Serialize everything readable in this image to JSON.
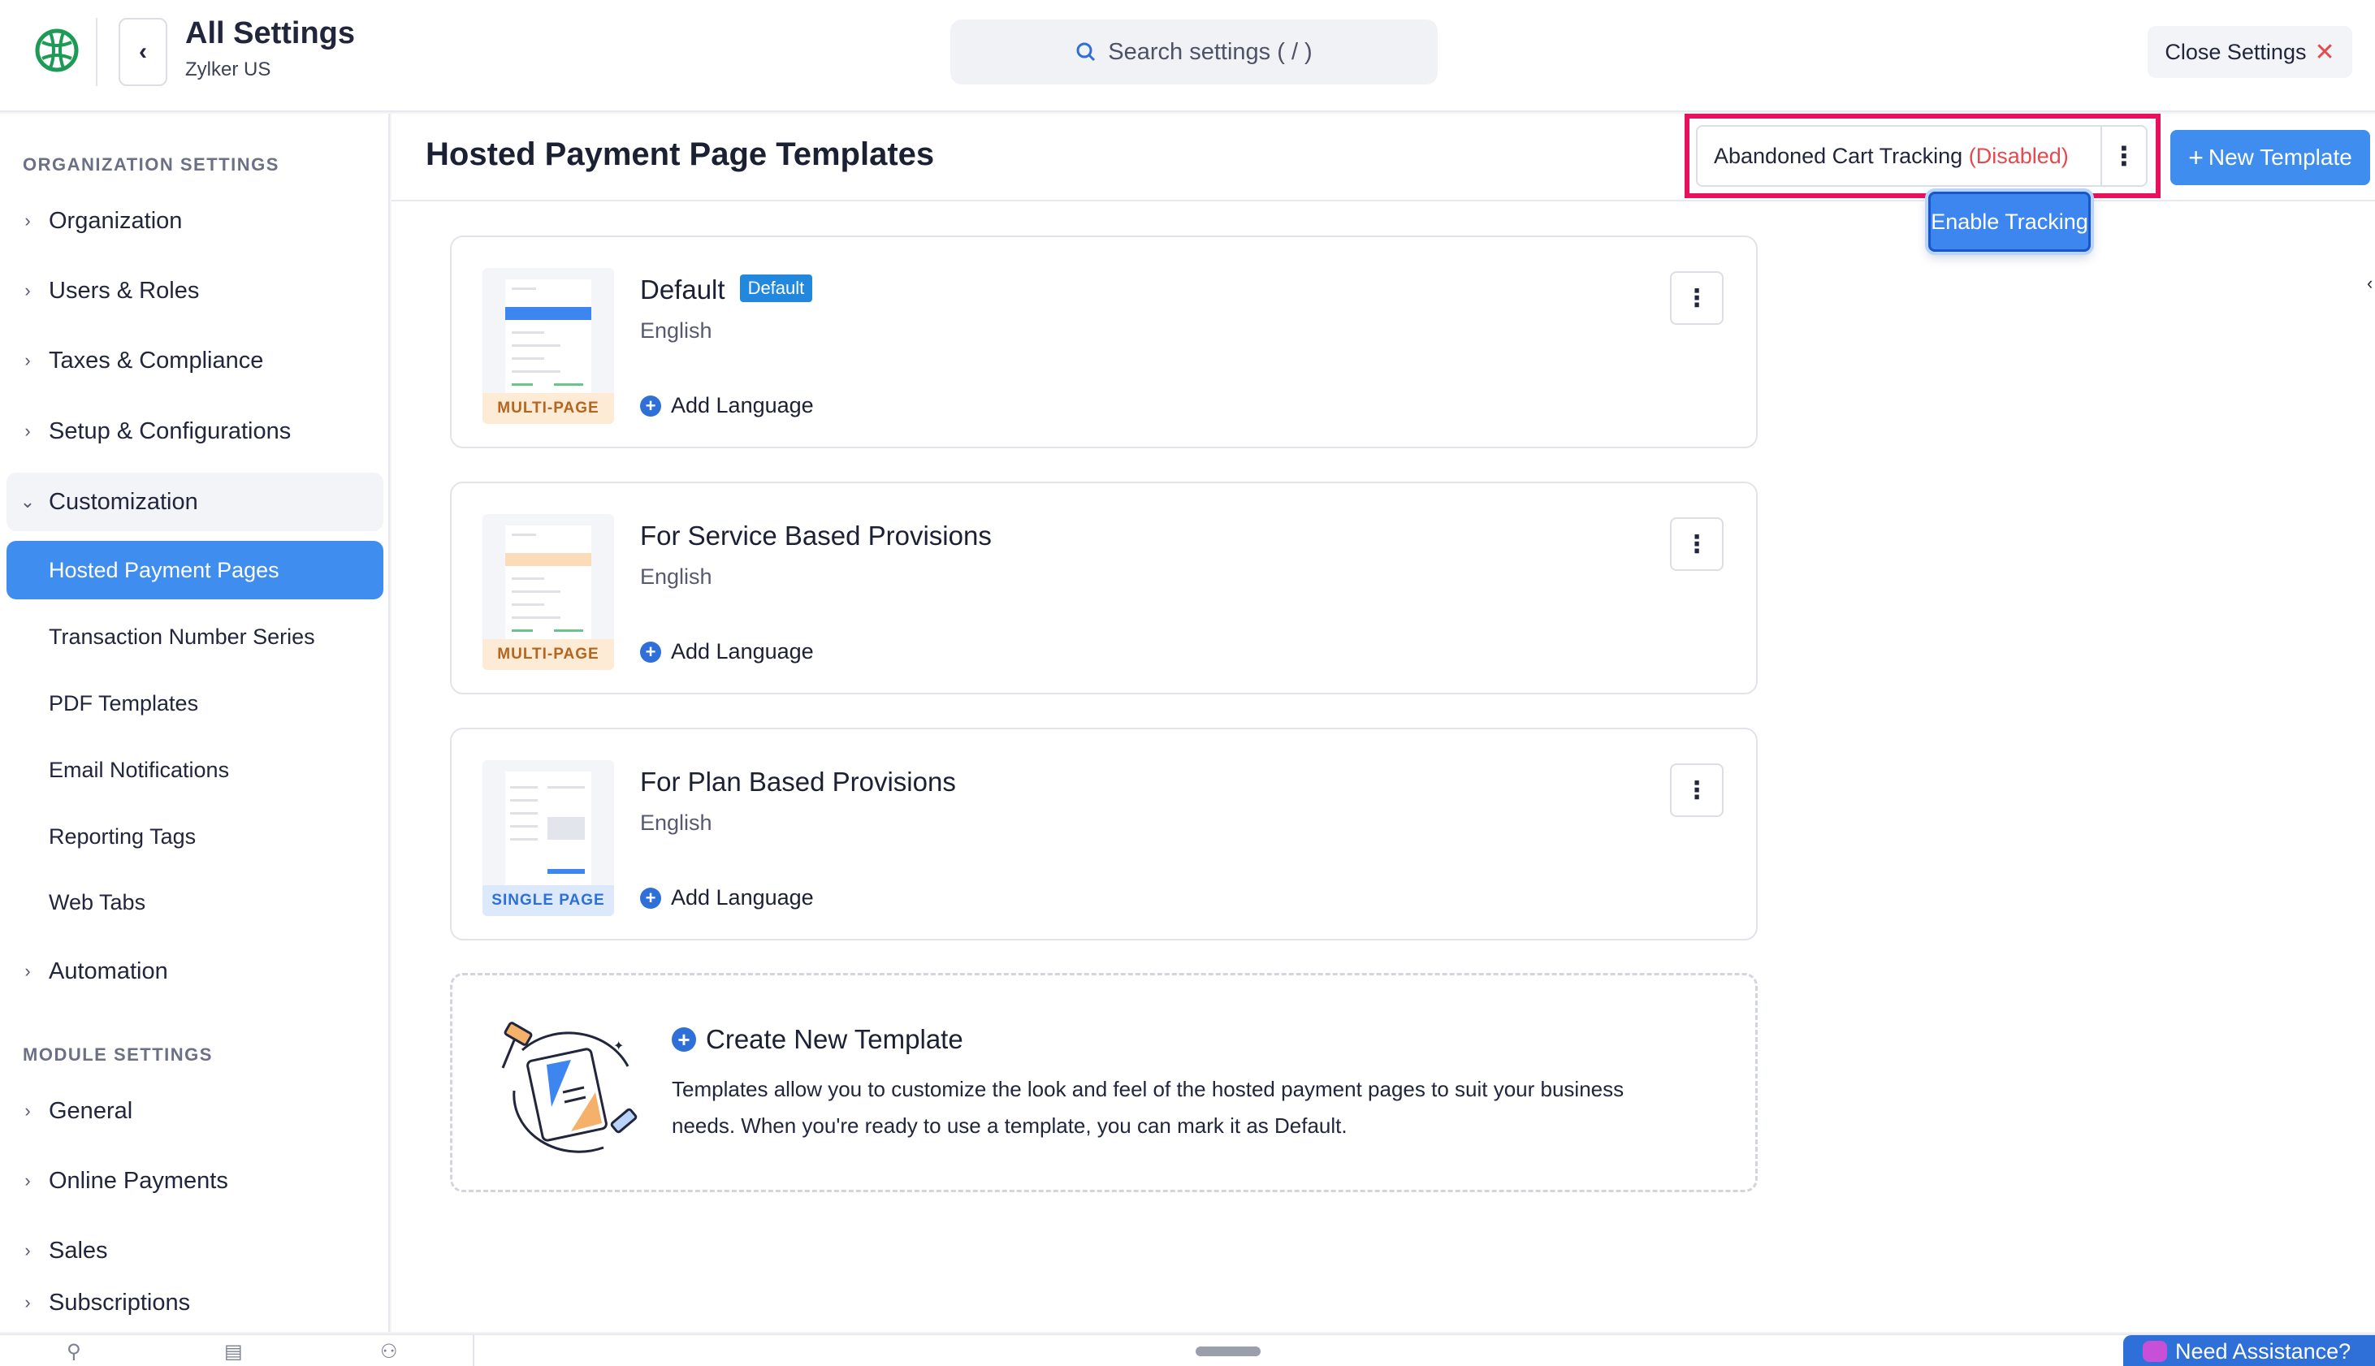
{
  "header": {
    "title": "All Settings",
    "subtitle": "Zylker US",
    "search_placeholder": "Search settings ( / )",
    "close_label": "Close Settings",
    "close_icon": "✕"
  },
  "sidebar": {
    "org_section": "ORGANIZATION SETTINGS",
    "org_items": [
      {
        "label": "Organization"
      },
      {
        "label": "Users & Roles"
      },
      {
        "label": "Taxes & Compliance"
      },
      {
        "label": "Setup & Configurations"
      },
      {
        "label": "Customization"
      }
    ],
    "customization_items": [
      {
        "label": "Hosted Payment Pages",
        "active": true
      },
      {
        "label": "Transaction Number Series"
      },
      {
        "label": "PDF Templates"
      },
      {
        "label": "Email Notifications"
      },
      {
        "label": "Reporting Tags"
      },
      {
        "label": "Web Tabs"
      }
    ],
    "automation_label": "Automation",
    "module_section": "MODULE SETTINGS",
    "module_items": [
      {
        "label": "General"
      },
      {
        "label": "Online Payments"
      },
      {
        "label": "Sales"
      },
      {
        "label": "Subscriptions"
      }
    ]
  },
  "main": {
    "title": "Hosted Payment Page Templates",
    "tracking_label": "Abandoned Cart Tracking",
    "tracking_status": "(Disabled)",
    "new_template_label": "New Template",
    "enable_tracking_label": "Enable Tracking",
    "templates": [
      {
        "name": "Default",
        "tag": "Default",
        "language": "English",
        "add_language": "Add Language",
        "badge": "MULTI-PAGE"
      },
      {
        "name": "For Service Based Provisions",
        "language": "English",
        "add_language": "Add Language",
        "badge": "MULTI-PAGE"
      },
      {
        "name": "For Plan Based Provisions",
        "language": "English",
        "add_language": "Add Language",
        "badge": "SINGLE PAGE"
      }
    ],
    "create": {
      "title": "Create New Template",
      "description": "Templates allow you to customize the look and feel of the hosted payment pages to suit your business needs. When you're ready to use a template, you can mark it as Default."
    }
  },
  "footer": {
    "assist_label": "Need Assistance?"
  },
  "colors": {
    "accent": "#408df0",
    "highlight": "#e8125c",
    "disabled": "#e5484d"
  }
}
